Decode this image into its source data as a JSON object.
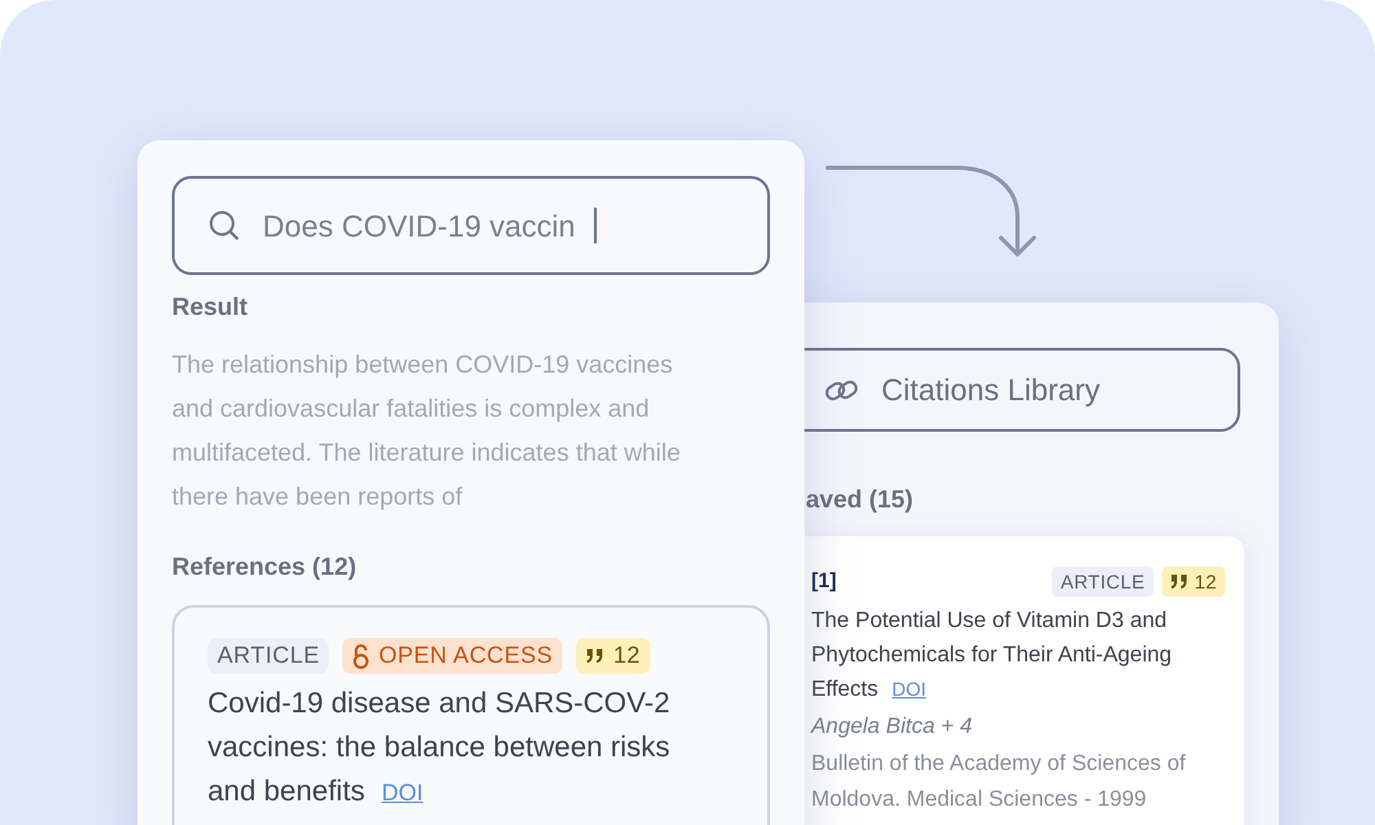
{
  "search": {
    "value": "Does COVID-19 vaccin"
  },
  "result": {
    "heading": "Result",
    "text": "The relationship between COVID-19 vaccines and cardiovascular fatalities is complex and multifaceted. The literature indicates that while there have been reports of"
  },
  "references": {
    "heading": "References (12)",
    "items": [
      {
        "badges": [
          {
            "kind": "type",
            "text": "ARTICLE"
          },
          {
            "kind": "open_access",
            "text": "OPEN ACCESS"
          },
          {
            "kind": "citations",
            "text": "12"
          }
        ],
        "title": "Covid-19 disease and SARS-COV-2 vaccines: the balance between risks and benefits",
        "link": "DOI"
      }
    ]
  },
  "library": {
    "button": "Citations Library",
    "heading": "aved (15)",
    "items": [
      {
        "index": "[1]",
        "badges": [
          {
            "kind": "type",
            "text": "ARTICLE"
          },
          {
            "kind": "citations",
            "text": "12"
          }
        ],
        "title": "The Potential Use of Vitamin D3 and Phytochemicals for Their Anti-Ageing Effects",
        "link": "DOI",
        "authors": "Angela Bitca + 4",
        "source": "Bulletin of the Academy of Sciences of Moldova. Medical Sciences - 1999"
      }
    ]
  }
}
